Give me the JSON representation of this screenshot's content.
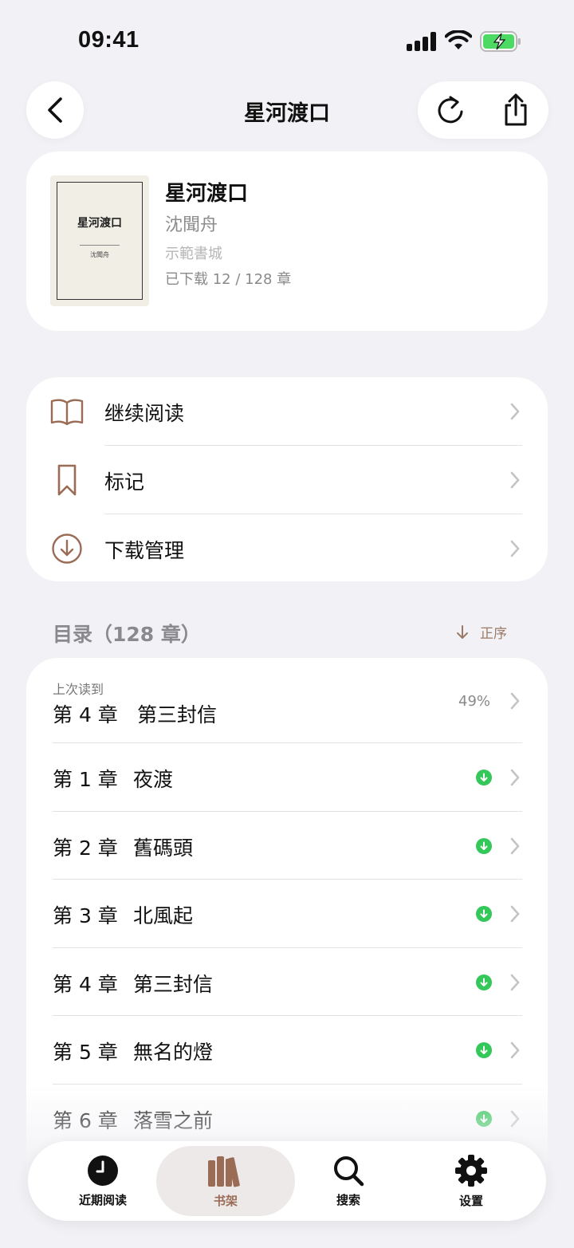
{
  "status_bar": {
    "time": "09:41"
  },
  "nav": {
    "title": "星河渡口"
  },
  "book": {
    "cover_title": "星河渡口",
    "cover_author": "沈聞舟",
    "title": "星河渡口",
    "author": "沈聞舟",
    "source": "示範書城",
    "download_status": "已下载 12 / 128 章"
  },
  "menu": [
    {
      "label": "继续阅读",
      "icon": "open-book-icon"
    },
    {
      "label": "标记",
      "icon": "bookmark-icon"
    },
    {
      "label": "下载管理",
      "icon": "download-circle-icon"
    }
  ],
  "toc": {
    "heading": "目录（128 章）",
    "sort_label": "正序",
    "last_read": {
      "label": "上次读到",
      "chapter_no": "第 4 章",
      "chapter_title": "第三封信",
      "progress": "49%"
    },
    "chapters": [
      {
        "no": "第 1 章",
        "title": "夜渡",
        "downloaded": true
      },
      {
        "no": "第 2 章",
        "title": "舊碼頭",
        "downloaded": true
      },
      {
        "no": "第 3 章",
        "title": "北風起",
        "downloaded": true
      },
      {
        "no": "第 4 章",
        "title": "第三封信",
        "downloaded": true
      },
      {
        "no": "第 5 章",
        "title": "無名的燈",
        "downloaded": true
      },
      {
        "no": "第 6 章",
        "title": "落雪之前",
        "downloaded": true
      }
    ]
  },
  "tabbar": {
    "tabs": [
      {
        "label": "近期阅读",
        "icon": "clock-icon",
        "active": false
      },
      {
        "label": "书架",
        "icon": "books-icon",
        "active": true
      },
      {
        "label": "搜索",
        "icon": "search-icon",
        "active": false
      },
      {
        "label": "设置",
        "icon": "gear-icon",
        "active": false
      }
    ]
  },
  "colors": {
    "accent": "#9a6b55",
    "download_green": "#34c759",
    "background": "#f2f2f6"
  }
}
